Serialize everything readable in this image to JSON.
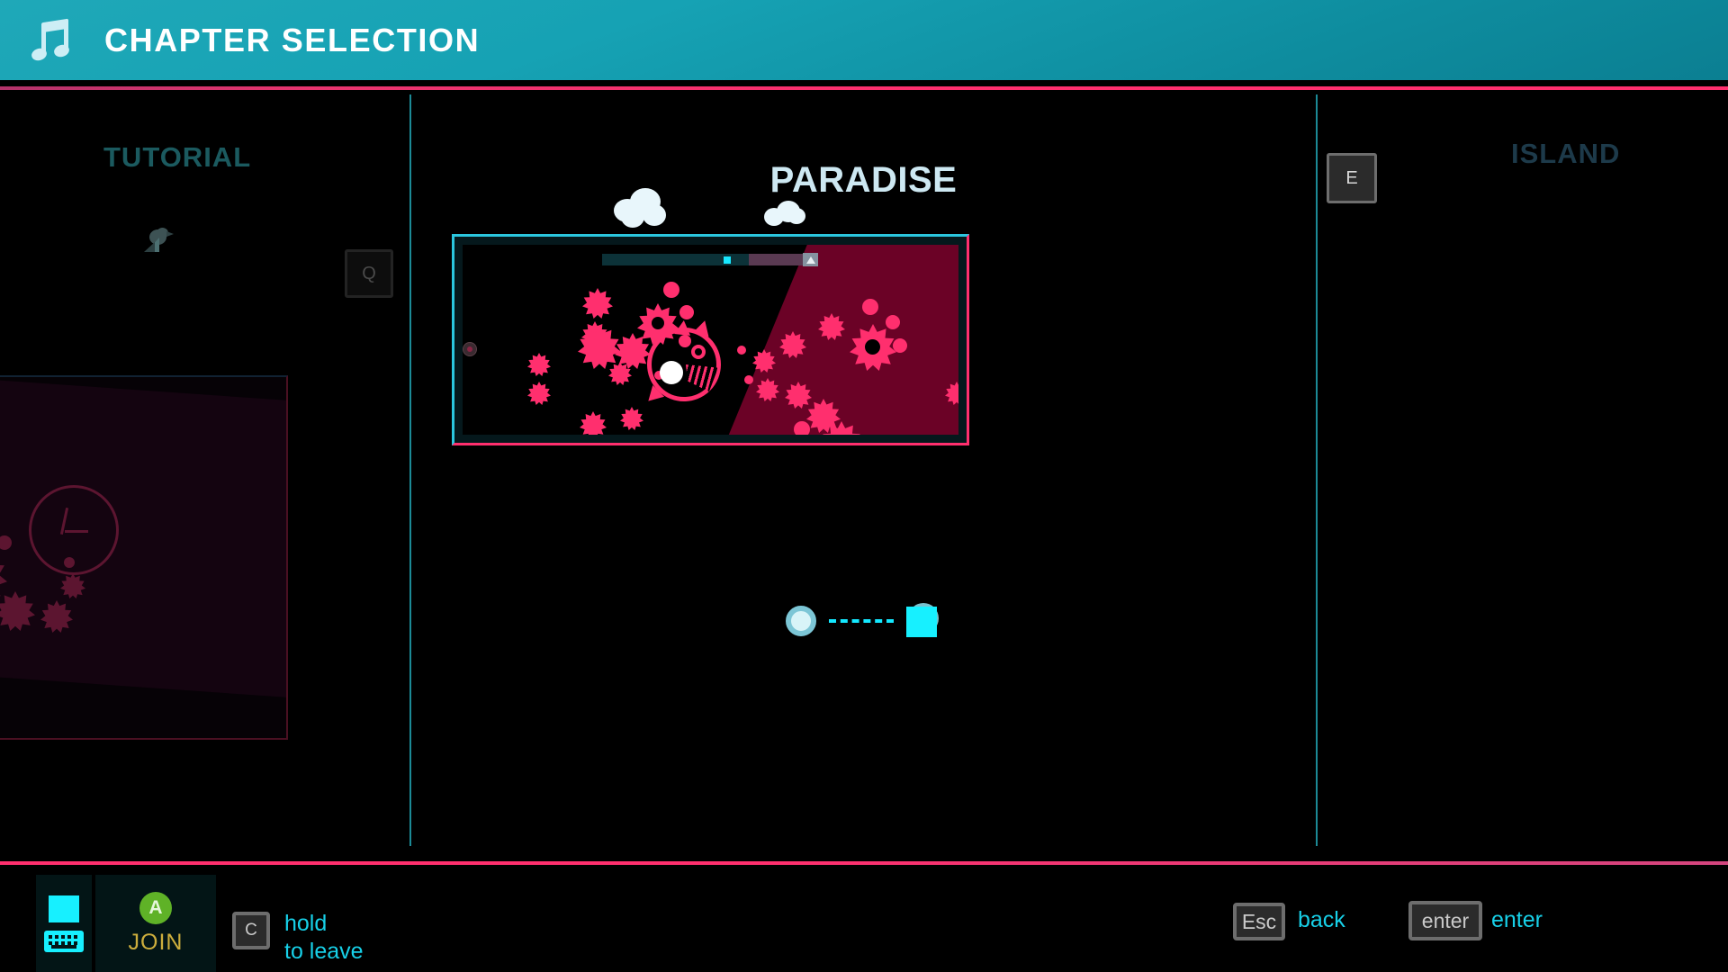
{
  "header": {
    "title": "CHAPTER SELECTION",
    "icon": "music-note-icon",
    "bg_color": "#16a2b4",
    "accent_line_color": "#ff2f6e"
  },
  "chapters": {
    "previous": {
      "title": "TUTORIAL",
      "key_hint": "Q",
      "icon": "bird-icon",
      "title_color": "#1b5a5f"
    },
    "current": {
      "title": "PARADISE",
      "title_color": "#cde8f2",
      "decoration": "clouds",
      "preview": {
        "border_top_color": "#2bc6de",
        "border_bottom_color": "#ff2f6e",
        "shape_color": "#ff2f6e",
        "danger_zone_color": "#6b0226",
        "progress_bar": {
          "track_color": "#0c3238",
          "marker_color": "#18e8ff",
          "marker_position_pct": 62,
          "flag_position_pct": 95
        }
      }
    },
    "next": {
      "title": "ISLAND",
      "key_hint": "E",
      "title_color": "#1d3a4a"
    }
  },
  "players": {
    "circle_label": "player-one-token",
    "square_label": "player-two-token",
    "link_color": "#13e8ff"
  },
  "footer": {
    "device": {
      "icon": "keyboard-icon",
      "indicator_color": "#17f0ff"
    },
    "join": {
      "button_glyph": "A",
      "button_color": "#5fb227",
      "label": "JOIN",
      "label_color": "#cdae3d"
    },
    "leave": {
      "key": "C",
      "line1": "hold",
      "line2": "to leave"
    },
    "back": {
      "key": "Esc",
      "label": "back"
    },
    "confirm": {
      "key": "enter",
      "label": "enter"
    }
  }
}
